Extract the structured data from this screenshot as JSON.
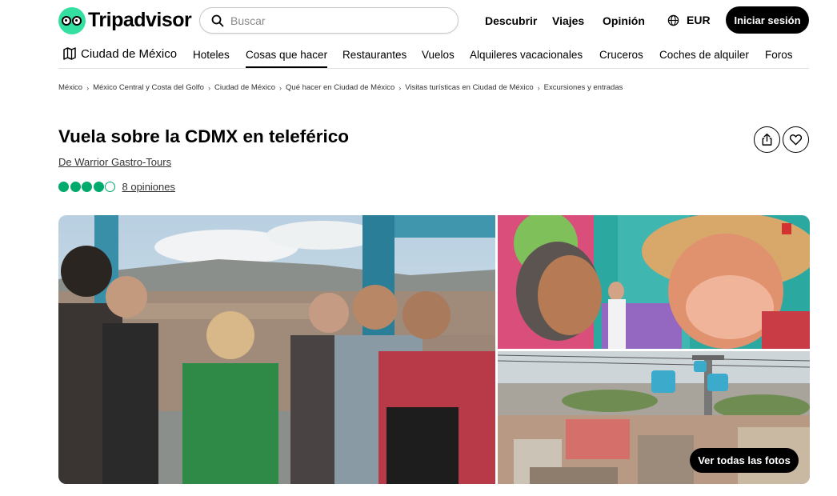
{
  "header": {
    "brand": "Tripadvisor",
    "search_placeholder": "Buscar",
    "nav": [
      "Descubrir",
      "Viajes",
      "Opinión"
    ],
    "currency": "EUR",
    "login_label": "Iniciar sesión"
  },
  "subnav": {
    "home": "Ciudad de México",
    "items": [
      "Hoteles",
      "Cosas que hacer",
      "Restaurantes",
      "Vuelos",
      "Alquileres vacacionales",
      "Cruceros",
      "Coches de alquiler",
      "Foros"
    ],
    "active": "Cosas que hacer"
  },
  "breadcrumb": [
    "México",
    "México Central y Costa del Golfo",
    "Ciudad de México",
    "Qué hacer en Ciudad de México",
    "Visitas turísticas en Ciudad de México",
    "Excursiones y entradas"
  ],
  "listing": {
    "title": "Vuela sobre la CDMX en teleférico",
    "author": "De Warrior Gastro-Tours",
    "rating": 4,
    "rating_max": 5,
    "reviews": "8 opiniones"
  },
  "gallery": {
    "see_all_label": "Ver todas las fotos"
  },
  "colors": {
    "brand_green": "#34e0a1",
    "rating_green": "#00aa6c",
    "button_black": "#000000"
  }
}
